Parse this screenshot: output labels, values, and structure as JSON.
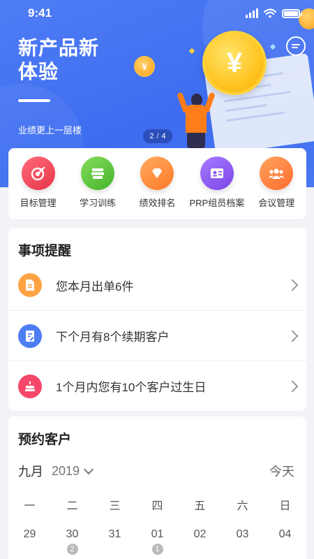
{
  "status_bar": {
    "time": "9:41"
  },
  "banner": {
    "title": "新产品新体验",
    "subtitle": "业绩更上一层楼",
    "pager_current": "2",
    "pager_separator": "/",
    "pager_total": "4",
    "coin_symbol": "¥"
  },
  "quick_menu": [
    {
      "label": "目标管理",
      "icon": "target-icon",
      "color": "#f04a5c"
    },
    {
      "label": "学习训练",
      "icon": "books-icon",
      "color": "#5cc53a"
    },
    {
      "label": "绩效排名",
      "icon": "diamond-icon",
      "color": "#ff8a3d"
    },
    {
      "label": "PRP组员档案",
      "icon": "id-card-icon",
      "color": "#8a55f0"
    },
    {
      "label": "会议管理",
      "icon": "group-icon",
      "color": "#ff7b3a"
    }
  ],
  "reminders": {
    "title": "事项提醒",
    "items": [
      {
        "text": "您本月出单6件",
        "icon": "document-icon",
        "color": "#ffa243"
      },
      {
        "text": "下个月有8个续期客户",
        "icon": "edit-doc-icon",
        "color": "#4d7df3"
      },
      {
        "text": "1个月内您有10个客户过生日",
        "icon": "cake-icon",
        "color": "#f5476a"
      }
    ]
  },
  "appointments": {
    "title": "预约客户",
    "month": "九月",
    "year": "2019",
    "today_label": "今天",
    "weekdays": [
      "一",
      "二",
      "三",
      "四",
      "五",
      "六",
      "日"
    ],
    "dates": [
      {
        "day": "29",
        "badge": ""
      },
      {
        "day": "30",
        "badge": "2"
      },
      {
        "day": "31",
        "badge": ""
      },
      {
        "day": "01",
        "badge": "1"
      },
      {
        "day": "02",
        "badge": ""
      },
      {
        "day": "03",
        "badge": ""
      },
      {
        "day": "04",
        "badge": ""
      }
    ]
  }
}
